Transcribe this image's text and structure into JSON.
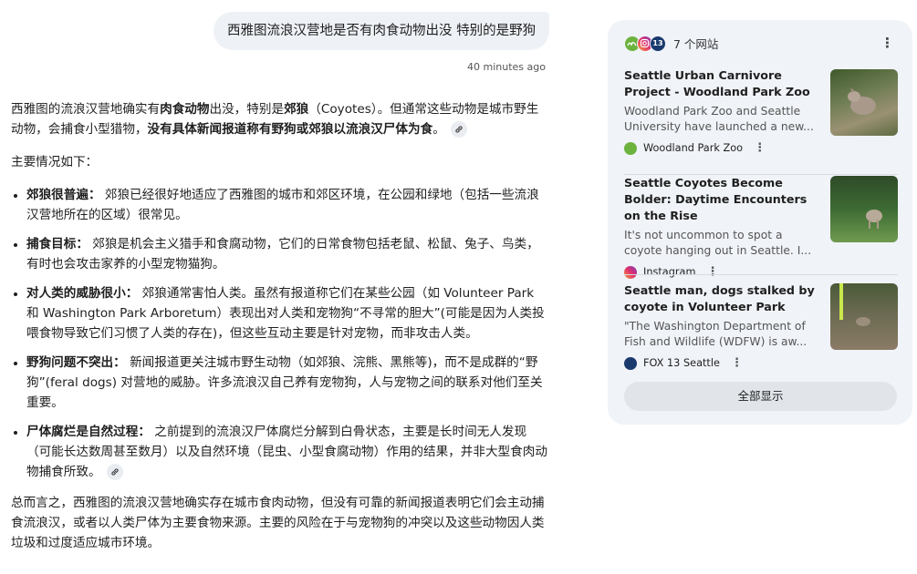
{
  "user_message": "西雅图流浪汉营地是否有肉食动物出没 特别的是野狗",
  "timestamp": "40 minutes ago",
  "answer": {
    "intro_1": "西雅图的流浪汉营地确实有",
    "intro_b1": "肉食动物",
    "intro_2": "出没，特别是",
    "intro_b2": "郊狼",
    "intro_3": "（Coyotes）。但通常这些动物是城市野生动物，会捕食小型猎物，",
    "intro_b3": "没有具体新闻报道称有野狗或郊狼以流浪汉尸体为食",
    "intro_4": "。",
    "lead": "主要情况如下：",
    "bullets": [
      {
        "title": "郊狼很普遍：",
        "text": " 郊狼已经很好地适应了西雅图的城市和郊区环境，在公园和绿地（包括一些流浪汉营地所在的区域）很常见。"
      },
      {
        "title": "捕食目标：",
        "text": " 郊狼是机会主义猎手和食腐动物，它们的日常食物包括老鼠、松鼠、兔子、鸟类，有时也会攻击家养的小型宠物猫狗。"
      },
      {
        "title": "对人类的威胁很小：",
        "text": " 郊狼通常害怕人类。虽然有报道称它们在某些公园（如 Volunteer Park 和 Washington Park Arboretum）表现出对人类和宠物狗“不寻常的胆大”(可能是因为人类投喂食物导致它们习惯了人类的存在)，但这些互动主要是针对宠物，而非攻击人类。"
      },
      {
        "title": "野狗问题不突出：",
        "text": " 新闻报道更关注城市野生动物（如郊狼、浣熊、黑熊等)，而不是成群的“野狗”(feral dogs) 对营地的威胁。许多流浪汉自己养有宠物狗，人与宠物之间的联系对他们至关重要。"
      },
      {
        "title": "尸体腐烂是自然过程：",
        "text": " 之前提到的流浪汉尸体腐烂分解到白骨状态，主要是长时间无人发现（可能长达数周甚至数月）以及自然环境（昆虫、小型食腐动物）作用的结果，并非大型食肉动物捕食所致。"
      }
    ],
    "conclusion": "总而言之，西雅图的流浪汉营地确实存在城市食肉动物，但没有可靠的新闻报道表明它们会主动捕食流浪汉，或者以人类尸体为主要食物来源。主要的风险在于与宠物狗的冲突以及这些动物因人类垃圾和过度适应城市环境。"
  },
  "sources_panel": {
    "header": "7 个网站",
    "icons": [
      "woodland-park-zoo-icon",
      "instagram-icon",
      "fox13-icon"
    ],
    "cards": [
      {
        "title": "Seattle Urban Carnivore Project - Woodland Park Zoo",
        "snippet": "Woodland Park Zoo and Seattle University have launched a new...",
        "source": "Woodland Park Zoo",
        "icon": "woodland-park-zoo-icon"
      },
      {
        "title": "Seattle Coyotes Become Bolder: Daytime Encounters on the Rise",
        "snippet": "It's not uncommon to spot a coyote hanging out in Seattle. I...",
        "source": "Instagram",
        "icon": "instagram-icon"
      },
      {
        "title": "Seattle man, dogs stalked by coyote in Volunteer Park",
        "snippet": "\"The Washington Department of Fish and Wildlife (WDFW) is aw...",
        "source": "FOX 13 Seattle",
        "icon": "fox13-icon"
      }
    ],
    "show_all": "全部显示"
  },
  "colors": {
    "panel_bg": "#f0f3f8",
    "user_bubble": "#eef1f6",
    "zoo_green": "#6cb33e",
    "fox_blue": "#1a3a6e"
  }
}
